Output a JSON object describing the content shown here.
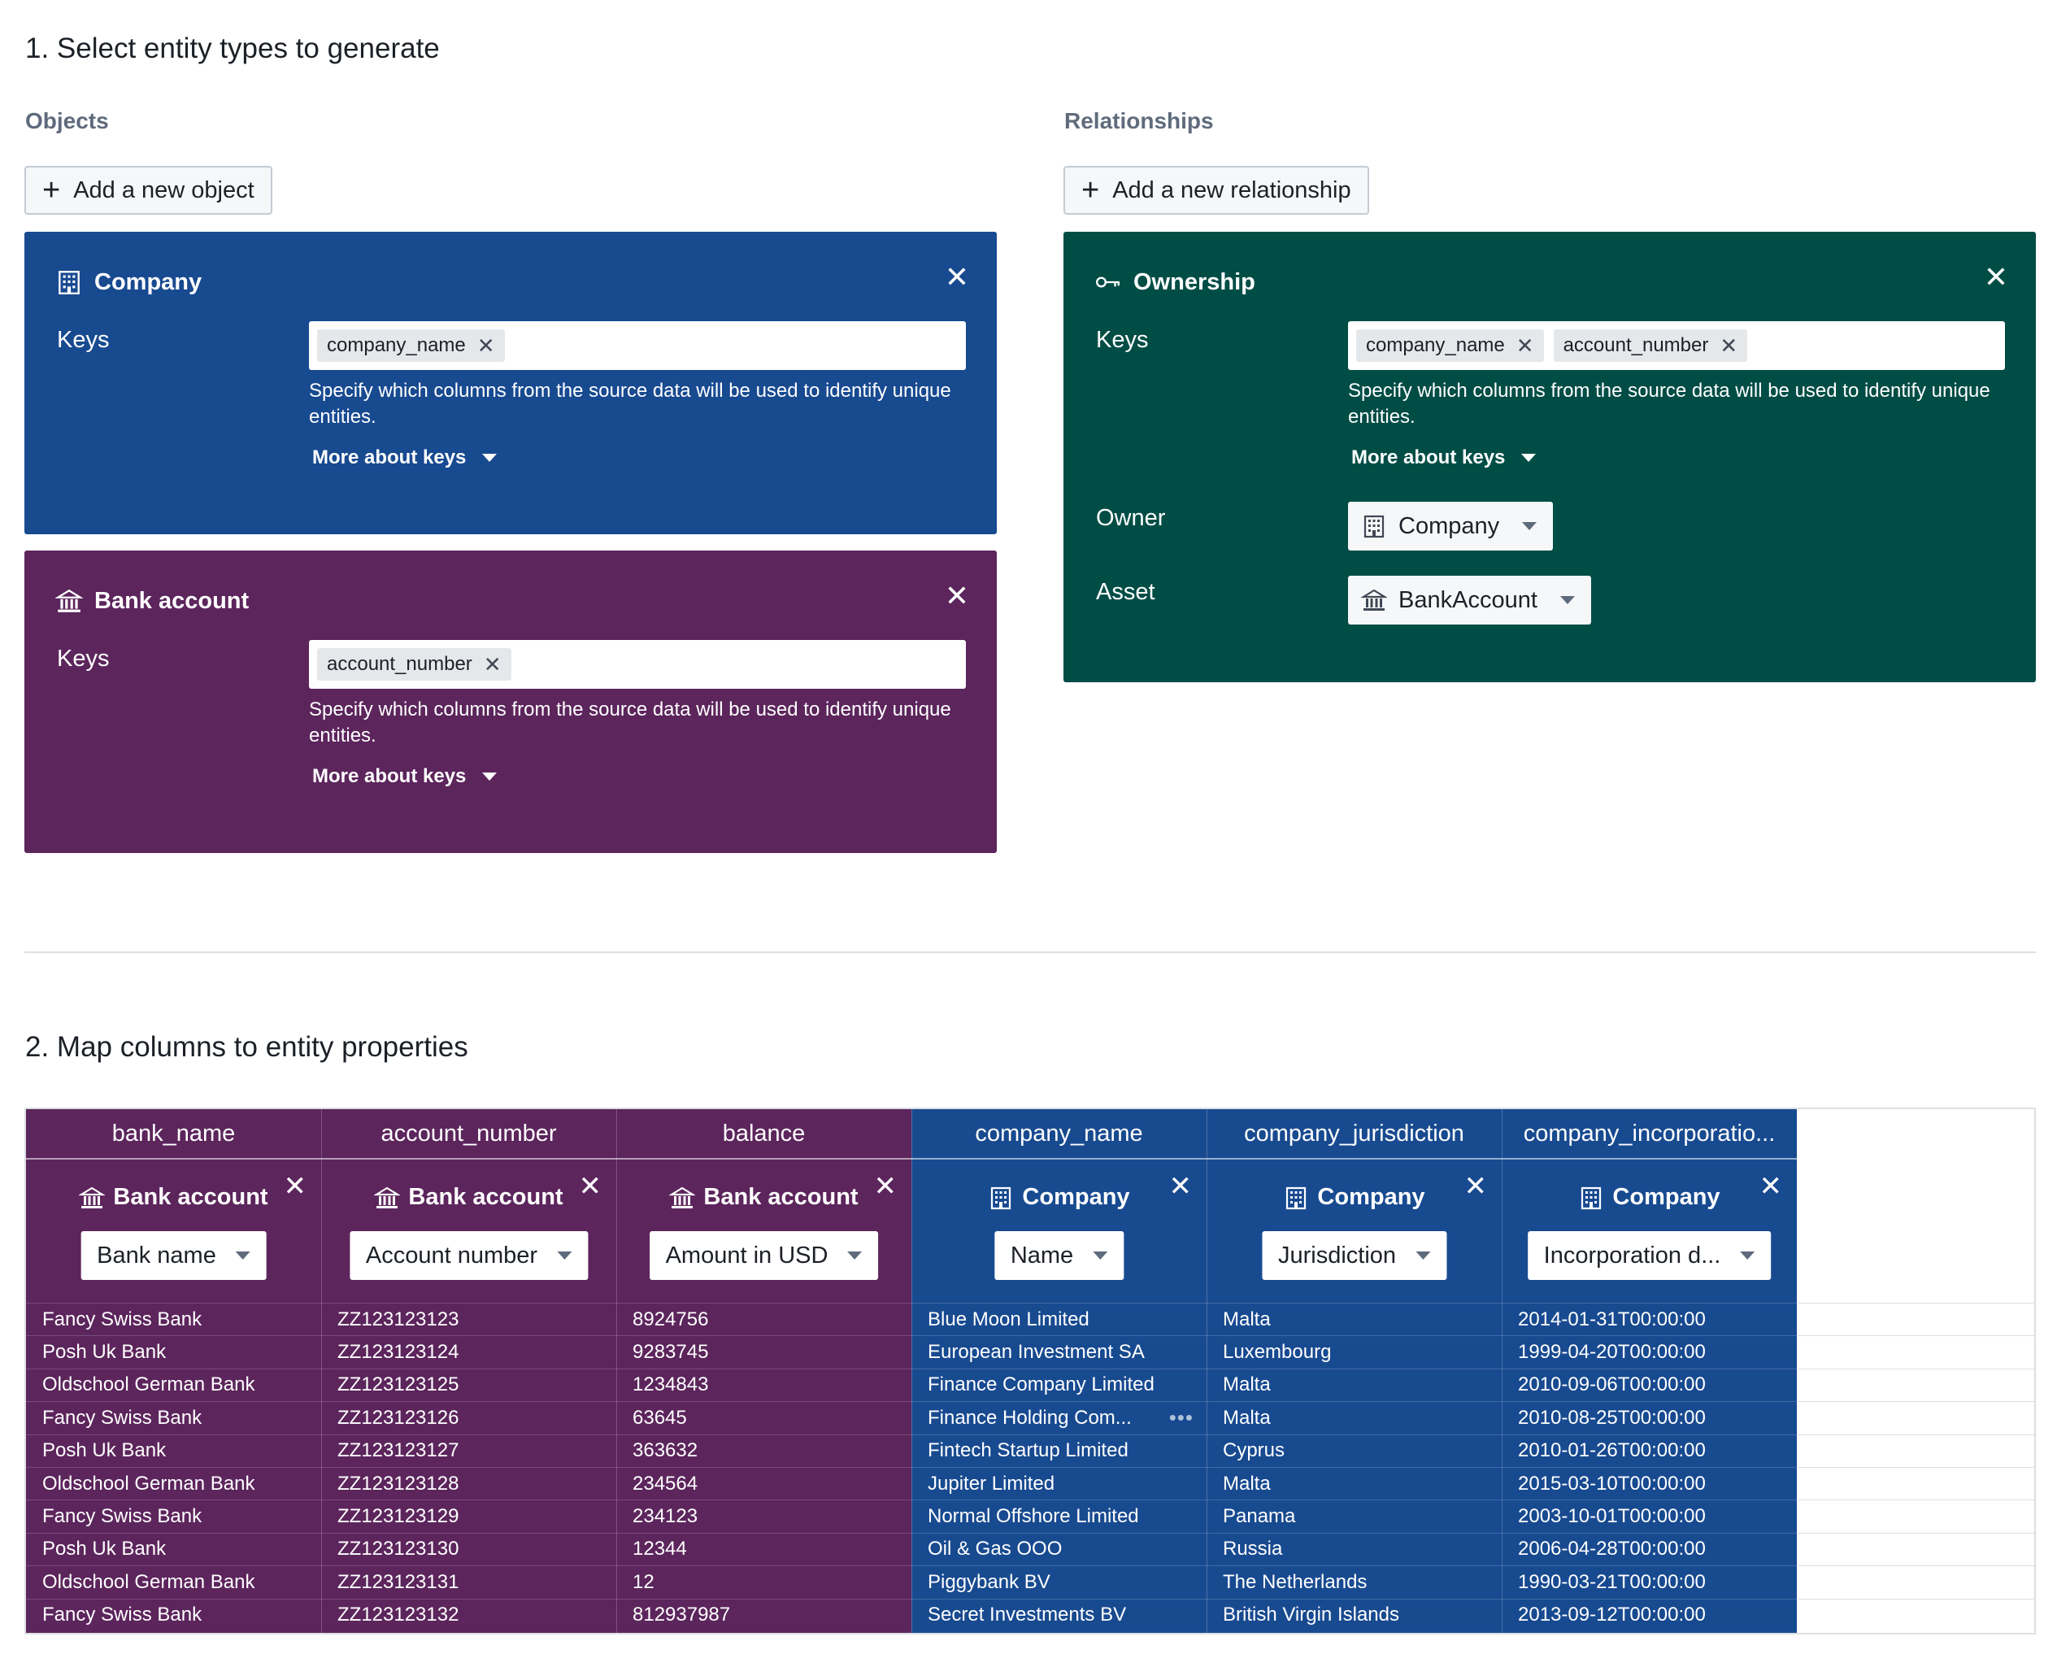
{
  "section1": {
    "title": "1. Select entity types to generate"
  },
  "objects": {
    "heading": "Objects",
    "add_button": "Add a new object",
    "cards": [
      {
        "title": "Company",
        "icon": "building-icon",
        "keys_label": "Keys",
        "keys": [
          "company_name"
        ],
        "helper": "Specify which columns from the source data will be used to identify unique entities.",
        "more": "More about keys",
        "color": "#184a90"
      },
      {
        "title": "Bank account",
        "icon": "bank-icon",
        "keys_label": "Keys",
        "keys": [
          "account_number"
        ],
        "helper": "Specify which columns from the source data will be used to identify unique entities.",
        "more": "More about keys",
        "color": "#5c255c"
      }
    ]
  },
  "relationships": {
    "heading": "Relationships",
    "add_button": "Add a new relationship",
    "card": {
      "title": "Ownership",
      "icon": "key-icon",
      "keys_label": "Keys",
      "keys": [
        "company_name",
        "account_number"
      ],
      "helper": "Specify which columns from the source data will be used to identify unique entities.",
      "more": "More about keys",
      "owner_label": "Owner",
      "owner_value": "Company",
      "asset_label": "Asset",
      "asset_value": "BankAccount",
      "color": "#004d46"
    }
  },
  "section2": {
    "title": "2. Map columns to entity properties"
  },
  "mapping": {
    "columns": [
      {
        "header": "bank_name",
        "entity": "Bank account",
        "property": "Bank name",
        "color": "#5c255c",
        "values": [
          "Fancy Swiss Bank",
          "Posh Uk Bank",
          "Oldschool German Bank",
          "Fancy Swiss Bank",
          "Posh Uk Bank",
          "Oldschool German Bank",
          "Fancy Swiss Bank",
          "Posh Uk Bank",
          "Oldschool German Bank",
          "Fancy Swiss Bank"
        ]
      },
      {
        "header": "account_number",
        "entity": "Bank account",
        "property": "Account number",
        "color": "#5c255c",
        "values": [
          "ZZ123123123",
          "ZZ123123124",
          "ZZ123123125",
          "ZZ123123126",
          "ZZ123123127",
          "ZZ123123128",
          "ZZ123123129",
          "ZZ123123130",
          "ZZ123123131",
          "ZZ123123132"
        ]
      },
      {
        "header": "balance",
        "entity": "Bank account",
        "property": "Amount in USD",
        "color": "#5c255c",
        "values": [
          "8924756",
          "9283745",
          "1234843",
          "63645",
          "363632",
          "234564",
          "234123",
          "12344",
          "12",
          "812937987"
        ]
      },
      {
        "header": "company_name",
        "entity": "Company",
        "property": "Name",
        "color": "#184a90",
        "values": [
          "Blue Moon Limited",
          "European Investment SA",
          "Finance Company Limited",
          "Finance Holding Com...",
          "Fintech Startup Limited",
          "Jupiter Limited",
          "Normal Offshore Limited",
          "Oil & Gas OOO",
          "Piggybank BV",
          "Secret Investments BV"
        ]
      },
      {
        "header": "company_jurisdiction",
        "entity": "Company",
        "property": "Jurisdiction",
        "color": "#184a90",
        "values": [
          "Malta",
          "Luxembourg",
          "Malta",
          "Malta",
          "Cyprus",
          "Malta",
          "Panama",
          "Russia",
          "The Netherlands",
          "British Virgin Islands"
        ]
      },
      {
        "header": "company_incorporatio...",
        "entity": "Company",
        "property": "Incorporation d...",
        "color": "#184a90",
        "values": [
          "2014-01-31T00:00:00",
          "1999-04-20T00:00:00",
          "2010-09-06T00:00:00",
          "2010-08-25T00:00:00",
          "2010-01-26T00:00:00",
          "2015-03-10T00:00:00",
          "2003-10-01T00:00:00",
          "2006-04-28T00:00:00",
          "1990-03-21T00:00:00",
          "2013-09-12T00:00:00"
        ]
      }
    ],
    "truncated_cell_marker": "•••"
  }
}
